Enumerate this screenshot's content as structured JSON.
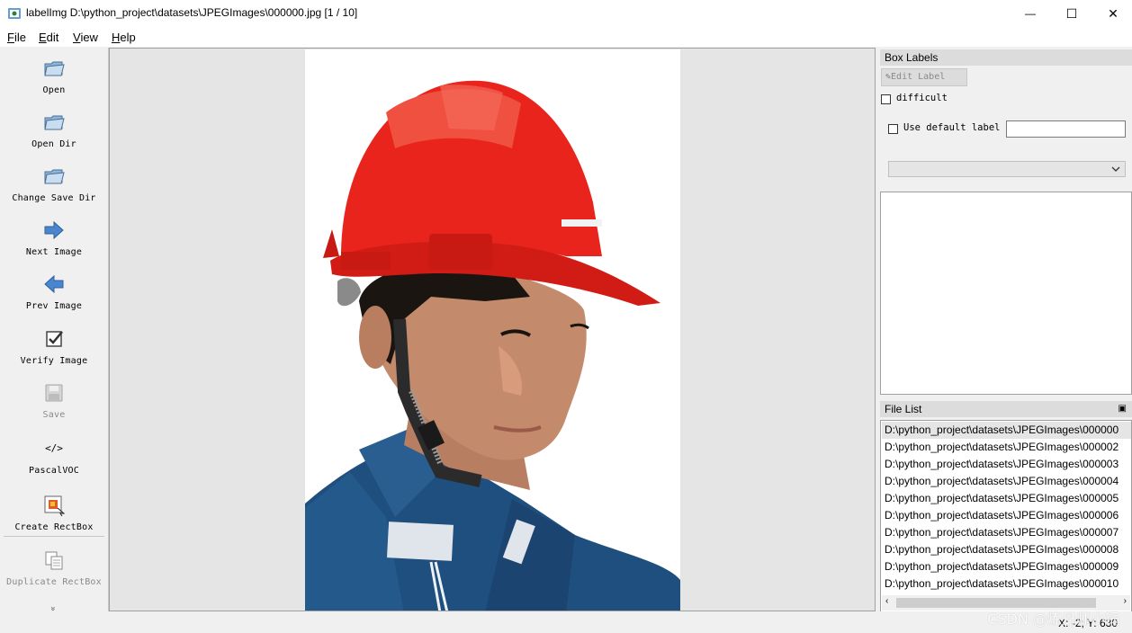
{
  "window": {
    "title": "labelImg D:\\python_project\\datasets\\JPEGImages\\000000.jpg [1 / 10]",
    "minimize_glyph": "—",
    "maximize_glyph": "☐",
    "close_glyph": "✕"
  },
  "menu": [
    {
      "key": "F",
      "rest": "ile"
    },
    {
      "key": "E",
      "rest": "dit"
    },
    {
      "key": "V",
      "rest": "iew"
    },
    {
      "key": "H",
      "rest": "elp"
    }
  ],
  "toolbar": {
    "open": "Open",
    "open_dir": "Open Dir",
    "change_save_dir": "Change Save Dir",
    "next_image": "Next Image",
    "prev_image": "Prev Image",
    "verify_image": "Verify Image",
    "save": "Save",
    "format_glyph": "</>",
    "format": "PascalVOC",
    "create_rectbox": "Create RectBox",
    "duplicate_rectbox": "Duplicate RectBox",
    "more_glyph": "»"
  },
  "box_labels": {
    "title": "Box Labels",
    "edit_label": "Edit Label",
    "difficult": "difficult",
    "use_default_label": "Use default label",
    "default_label_value": "",
    "combo_value": ""
  },
  "file_list": {
    "title": "File List",
    "files": [
      "D:\\python_project\\datasets\\JPEGImages\\000000",
      "D:\\python_project\\datasets\\JPEGImages\\000002",
      "D:\\python_project\\datasets\\JPEGImages\\000003",
      "D:\\python_project\\datasets\\JPEGImages\\000004",
      "D:\\python_project\\datasets\\JPEGImages\\000005",
      "D:\\python_project\\datasets\\JPEGImages\\000006",
      "D:\\python_project\\datasets\\JPEGImages\\000007",
      "D:\\python_project\\datasets\\JPEGImages\\000008",
      "D:\\python_project\\datasets\\JPEGImages\\000009",
      "D:\\python_project\\datasets\\JPEGImages\\000010"
    ],
    "selected_index": 0
  },
  "status": {
    "coords": "X: -2; Y: 630"
  },
  "watermark": "CSDN @炼丹师小锅",
  "colors": {
    "helmet": "#e8241c",
    "shirt": "#1f4f7e",
    "arrow": "#3f7fcf"
  }
}
